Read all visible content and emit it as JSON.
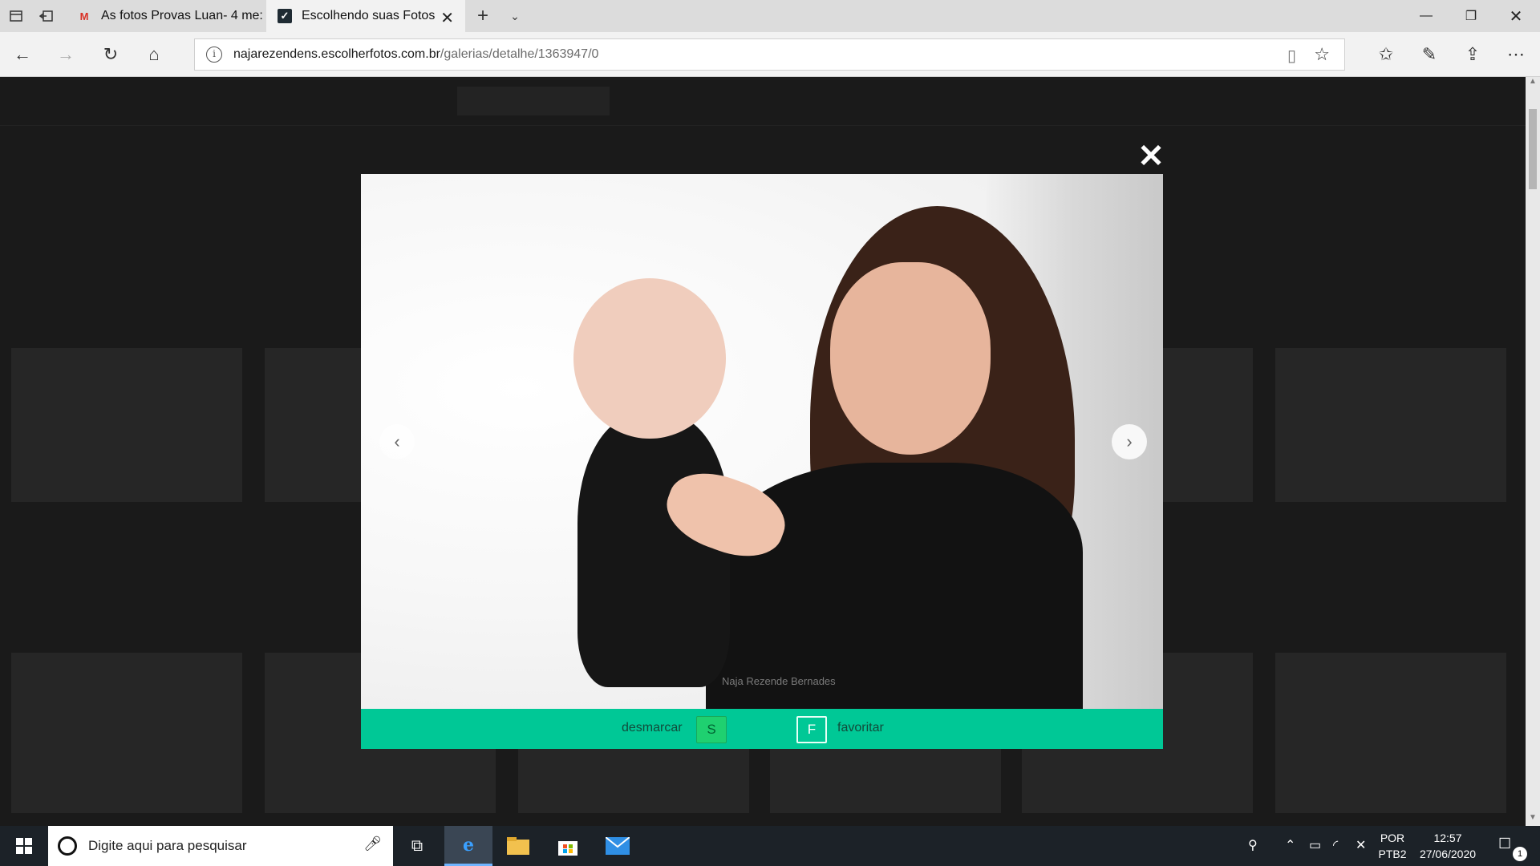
{
  "browser": {
    "tabs": [
      {
        "favicon": "gmail-icon",
        "title": "As fotos Provas Luan- 4 me:"
      },
      {
        "favicon": "checkmark-icon",
        "title": "Escolhendo suas Fotos"
      }
    ],
    "url_host": "najarezendens.escolherfotos.com.br",
    "url_path": "/galerias/detalhe/1363947/0"
  },
  "lightbox": {
    "watermark": "Naja Rezende Bernades",
    "unmark_label": "desmarcar",
    "unmark_key": "S",
    "favorite_key": "F",
    "favorite_label": "favoritar"
  },
  "taskbar": {
    "search_placeholder": "Digite aqui para pesquisar",
    "lang_top": "POR",
    "lang_bottom": "PTB2",
    "time": "12:57",
    "date": "27/06/2020",
    "notifications": "1"
  },
  "colors": {
    "accent": "#00c896",
    "unmark_key_bg": "#1fd070"
  }
}
